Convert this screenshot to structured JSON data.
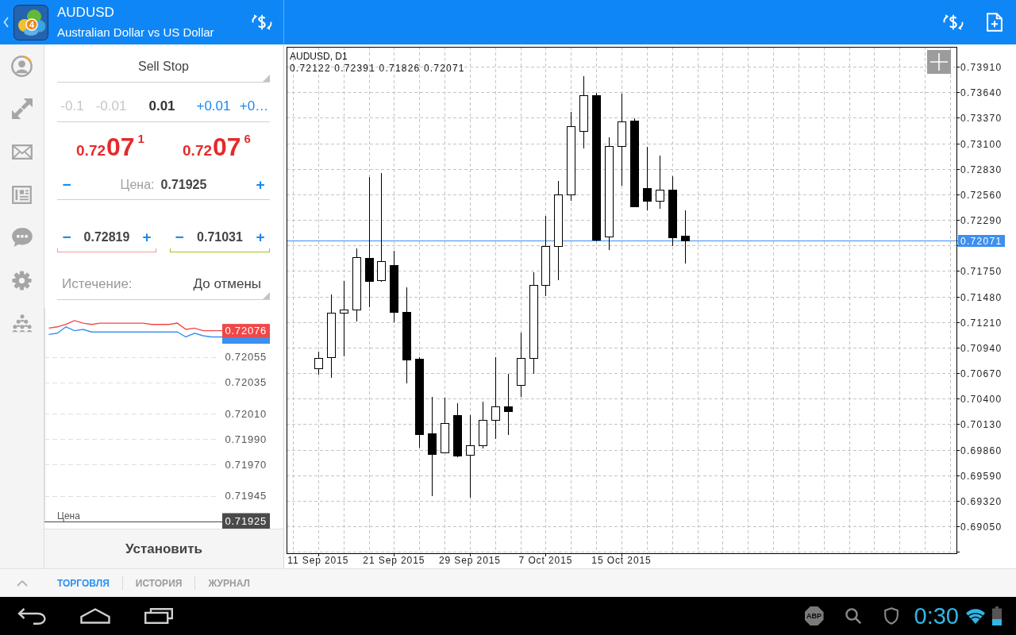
{
  "header": {
    "logo_mark": "4",
    "symbol": "AUDUSD",
    "description": "Australian Dollar vs US Dollar"
  },
  "chart": {
    "chart_data": [
      {
        "type": "candlestick",
        "title": "AUDUSD, D1",
        "subtitle": "0.72122 0.72391 0.71826 0.72071",
        "categories": [
          null,
          null,
          "11 Sep 2015",
          null,
          null,
          null,
          null,
          null,
          "21 Sep 2015",
          null,
          null,
          null,
          null,
          null,
          "29 Sep 2015",
          null,
          null,
          null,
          null,
          null,
          "7 Oct 2015",
          null,
          null,
          null,
          null,
          null,
          "15 Oct 2015",
          null,
          null,
          null,
          null,
          null,
          null,
          null,
          null,
          null,
          null,
          null,
          null,
          null,
          null,
          null,
          null,
          null,
          null,
          null,
          null,
          null,
          null,
          null,
          null,
          null,
          null
        ],
        "ohlc": [
          null,
          null,
          [
            0.7072,
            0.709,
            0.7065,
            0.7083
          ],
          [
            0.70835,
            0.71501,
            0.70622,
            0.71306
          ],
          [
            0.71306,
            0.71644,
            0.70849,
            0.71339
          ],
          [
            0.71339,
            0.71986,
            0.71218,
            0.71893
          ],
          [
            0.71885,
            0.72746,
            0.71369,
            0.71648
          ],
          [
            0.71651,
            0.72783,
            0.71639,
            0.71851
          ],
          [
            0.71812,
            0.71963,
            0.71208,
            0.71314
          ],
          [
            0.71317,
            0.71577,
            0.70564,
            0.70815
          ],
          [
            0.70821,
            0.70838,
            0.69879,
            0.70027
          ],
          [
            0.70032,
            0.70419,
            0.69372,
            0.69817
          ],
          [
            0.69829,
            0.70413,
            0.69823,
            0.70142
          ],
          [
            0.70226,
            0.70349,
            0.69783,
            0.698
          ],
          [
            0.69803,
            0.70228,
            0.69356,
            0.69907
          ],
          [
            0.69907,
            0.70371,
            0.6987,
            0.70175
          ],
          [
            0.70173,
            0.70838,
            0.69971,
            0.70318
          ],
          [
            0.70318,
            0.70662,
            0.70018,
            0.7027
          ],
          [
            0.70542,
            0.71098,
            0.70419,
            0.70827
          ],
          [
            0.70827,
            0.71734,
            0.70662,
            0.71599
          ],
          [
            0.71599,
            0.72332,
            0.71487,
            0.72013
          ],
          [
            0.72011,
            0.72701,
            0.7165,
            0.72556
          ],
          [
            0.72559,
            0.73432,
            0.72494,
            0.73278
          ],
          [
            0.7323,
            0.73809,
            0.73048,
            0.73605
          ],
          [
            0.73608,
            0.73633,
            0.72066,
            0.72083
          ],
          [
            0.72111,
            0.73163,
            0.71974,
            0.73068
          ],
          [
            0.73068,
            0.73625,
            0.72649,
            0.73333
          ],
          [
            0.73337,
            0.73362,
            0.7243,
            0.72435
          ],
          [
            0.72623,
            0.73062,
            0.72388,
            0.72494
          ],
          [
            0.72494,
            0.7297,
            0.7241,
            0.72609
          ],
          [
            0.72609,
            0.72754,
            0.72013,
            0.72108
          ],
          [
            0.72122,
            0.72391,
            0.71826,
            0.72071
          ],
          null,
          null,
          null,
          null,
          null,
          null,
          null,
          null,
          null,
          null,
          null,
          null,
          null,
          null,
          null,
          null,
          null,
          null,
          null,
          null,
          null
        ],
        "ylim": [
          0.68765,
          0.7412
        ],
        "yticks": [
          {
            "value": 0.7391,
            "label": "0.73910"
          },
          {
            "value": 0.7364,
            "label": "0.73640"
          },
          {
            "value": 0.7337,
            "label": "0.73370"
          },
          {
            "value": 0.731,
            "label": "0.73100"
          },
          {
            "value": 0.7283,
            "label": "0.72830"
          },
          {
            "value": 0.7256,
            "label": "0.72560"
          },
          {
            "value": 0.7229,
            "label": "0.72290"
          },
          {
            "value": 0.7175,
            "label": "0.71750"
          },
          {
            "value": 0.7148,
            "label": "0.71480"
          },
          {
            "value": 0.7121,
            "label": "0.71210"
          },
          {
            "value": 0.7094,
            "label": "0.70940"
          },
          {
            "value": 0.7067,
            "label": "0.70670"
          },
          {
            "value": 0.704,
            "label": "0.70400"
          },
          {
            "value": 0.7013,
            "label": "0.70130"
          },
          {
            "value": 0.6986,
            "label": "0.69860"
          },
          {
            "value": 0.6959,
            "label": "0.69590"
          },
          {
            "value": 0.6932,
            "label": "0.69320"
          },
          {
            "value": 0.6905,
            "label": "0.69050"
          }
        ],
        "ref_lines": [
          {
            "axis": "y",
            "value": 0.72071,
            "label": "0.72071",
            "color": "#3d8ff0"
          }
        ],
        "grid": true
      }
    ]
  },
  "order": {
    "type": "Sell Stop",
    "volume": {
      "decrements": [
        {
          "label": "-0.1",
          "disabled": true
        },
        {
          "label": "-0.01",
          "disabled": true
        }
      ],
      "value": "0.01",
      "increments": [
        {
          "label": "+0.01",
          "disabled": false
        },
        {
          "label": "+0…",
          "disabled": false
        }
      ]
    },
    "quotes": [
      {
        "prefix": "0.72",
        "pips": "07",
        "point": "1"
      },
      {
        "prefix": "0.72",
        "pips": "07",
        "point": "6"
      }
    ],
    "price": {
      "minus": "−",
      "label": "Цена:",
      "value": "0.71925",
      "plus": "+"
    },
    "stops": [
      {
        "minus": "−",
        "value": "0.72819",
        "plus": "+",
        "color": "#f29a9a"
      },
      {
        "minus": "−",
        "value": "0.71031",
        "plus": "+",
        "color": "#a6c41c"
      }
    ],
    "expiration": {
      "label": "Истечение:",
      "value": "До отмены"
    },
    "tick_chart": {
      "chart_data": [
        {
          "type": "line",
          "series": [
            {
              "color": "#f04848",
              "values": [
                0.72078,
                0.72079,
                0.72081,
                0.72084,
                0.72082,
                0.72081,
                0.72082,
                0.72082,
                0.72082,
                0.72082,
                0.72082,
                0.72082,
                0.72081,
                0.72081,
                0.72081,
                0.72082,
                0.72077,
                0.72078,
                0.72076,
                0.72076
              ]
            },
            {
              "color": "#3d8ff0",
              "values": [
                0.72073,
                0.72074,
                0.72079,
                0.72076,
                0.72077,
                0.72075,
                0.72075,
                0.72075,
                0.72075,
                0.72075,
                0.72075,
                0.72075,
                0.72075,
                0.72075,
                0.72075,
                0.72075,
                0.72071,
                0.72074,
                0.72072,
                0.72071
              ]
            }
          ],
          "ylim": [
            0.71925,
            0.72094
          ],
          "yticks": [
            {
              "value": 0.72076,
              "label": "0.72076"
            },
            {
              "value": 0.72055,
              "label": "0.72055"
            },
            {
              "value": 0.72035,
              "label": "0.72035"
            },
            {
              "value": 0.7201,
              "label": "0.72010"
            },
            {
              "value": 0.7199,
              "label": "0.71990"
            },
            {
              "value": 0.7197,
              "label": "0.71970"
            },
            {
              "value": 0.71945,
              "label": "0.71945"
            },
            {
              "value": 0.71925,
              "label": "0.71925"
            }
          ],
          "ref_lines": [
            {
              "axis": "y",
              "value": 0.71925,
              "label": "Цена",
              "color": "#4a4a4a"
            }
          ],
          "grid": true
        }
      ]
    },
    "submit": "Установить"
  },
  "tabs": [
    {
      "label": "ТОРГОВЛЯ",
      "selected": true
    },
    {
      "label": "ИСТОРИЯ",
      "selected": false
    },
    {
      "label": "ЖУРНАЛ",
      "selected": false
    }
  ],
  "system_bar": {
    "badge": "ABP",
    "clock": "0:30"
  }
}
